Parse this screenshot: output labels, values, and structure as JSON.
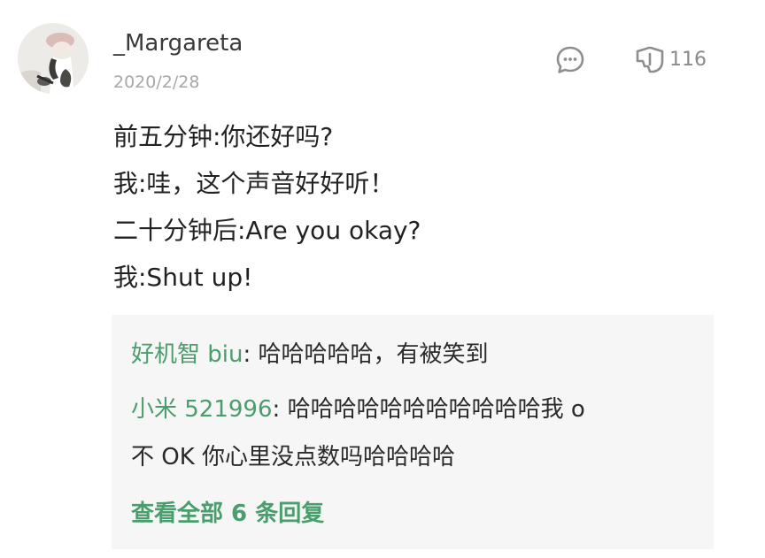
{
  "comment": {
    "username": "_Margareta",
    "date": "2020/2/28",
    "like_count": "116",
    "icons": {
      "avatar": "avatar-photo",
      "reply": "chat-bubble-icon",
      "like": "like-thumb-icon"
    },
    "body_lines": [
      "前五分钟:你还好吗?",
      "我:哇，这个声音好好听！",
      "二十分钟后:Are you okay?",
      "我:Shut up!"
    ]
  },
  "replies": {
    "items": [
      {
        "author": "好机智 biu",
        "separator": ": ",
        "lines": [
          "哈哈哈哈哈，有被笑到"
        ]
      },
      {
        "author": "小米 521996",
        "separator": ": ",
        "lines": [
          "哈哈哈哈哈哈哈哈哈哈哈我 o",
          "不 OK 你心里没点数吗哈哈哈哈"
        ]
      }
    ],
    "view_all": "查看全部 6 条回复"
  },
  "colors": {
    "accent_green": "#4a9d6c",
    "body_text": "#222222",
    "meta_gray": "#a8a8a8",
    "reply_background": "#f6f6f6"
  }
}
